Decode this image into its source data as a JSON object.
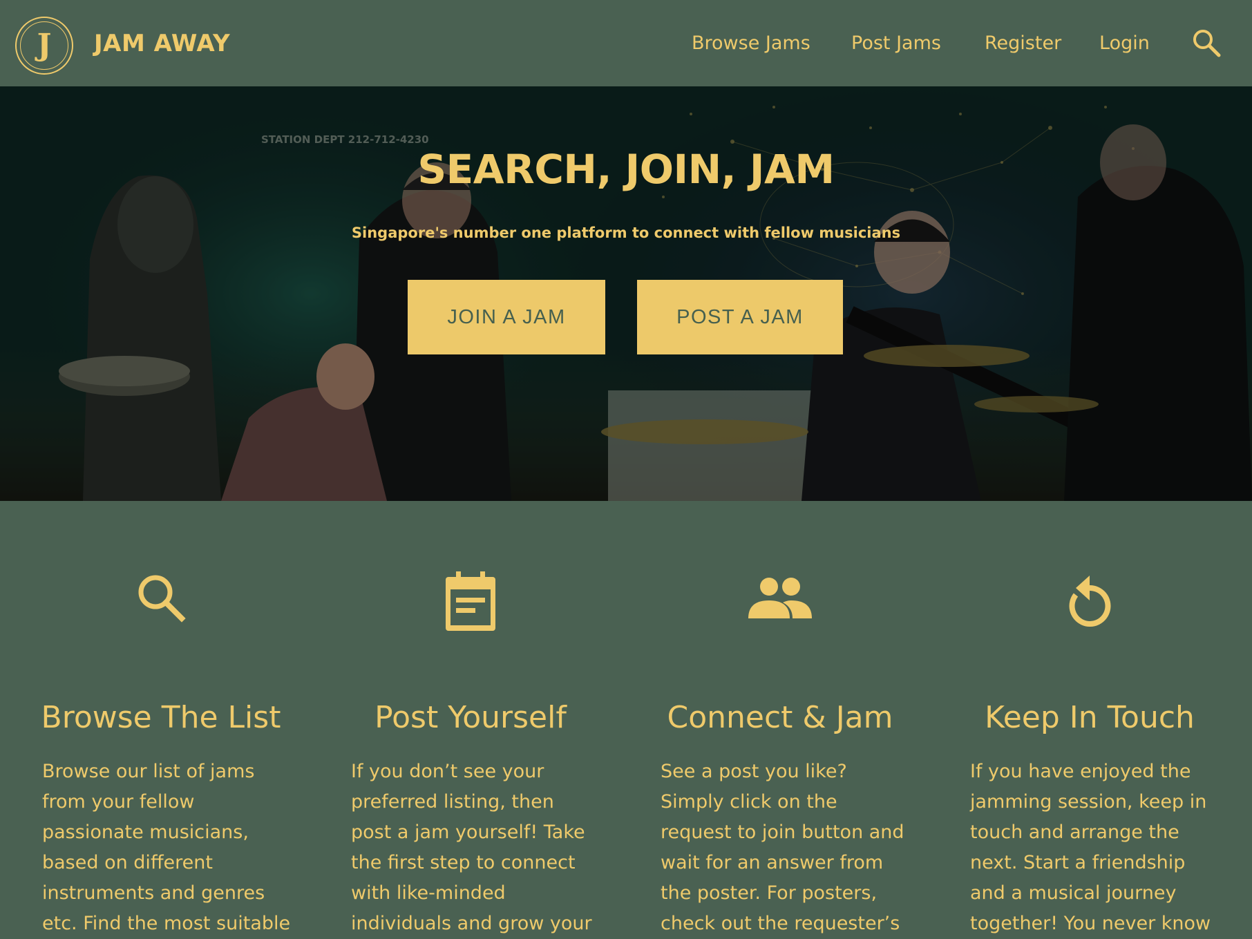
{
  "navbar": {
    "logo_letter": "J",
    "brand": "JAM AWAY",
    "links": [
      "Browse Jams",
      "Post Jams",
      "Register",
      "Login"
    ],
    "search_icon": "search-icon"
  },
  "hero": {
    "title": "SEARCH, JOIN, JAM",
    "subtitle": "Singapore's number one platform to connect with fellow musicians",
    "join_button": "JOIN A JAM",
    "post_button": "POST A JAM",
    "background": "photo of band members rehearsing in a studio"
  },
  "features": [
    {
      "icon": "search-icon",
      "title": "Browse The List",
      "text": "Browse our list of jams from your fellow passionate musicians, based on different instruments and genres etc. Find the most suitable"
    },
    {
      "icon": "calendar-icon",
      "title": "Post Yourself",
      "text": "If you don’t see your preferred listing, then post a jam yourself! Take the first step to connect with like-minded individuals and grow your"
    },
    {
      "icon": "people-icon",
      "title": "Connect & Jam",
      "text": "See a post you like? Simply click on the request to join button and wait for an answer from the poster. For posters, check out the requester’s"
    },
    {
      "icon": "replay-icon",
      "title": "Keep In Touch",
      "text": "If you have enjoyed the jamming session, keep in touch and arrange the next. Start a friendship and a musical journey together! You never know"
    }
  ],
  "colors": {
    "background": "#4a6152",
    "accent": "#efca6b",
    "button_text": "#46604f"
  }
}
